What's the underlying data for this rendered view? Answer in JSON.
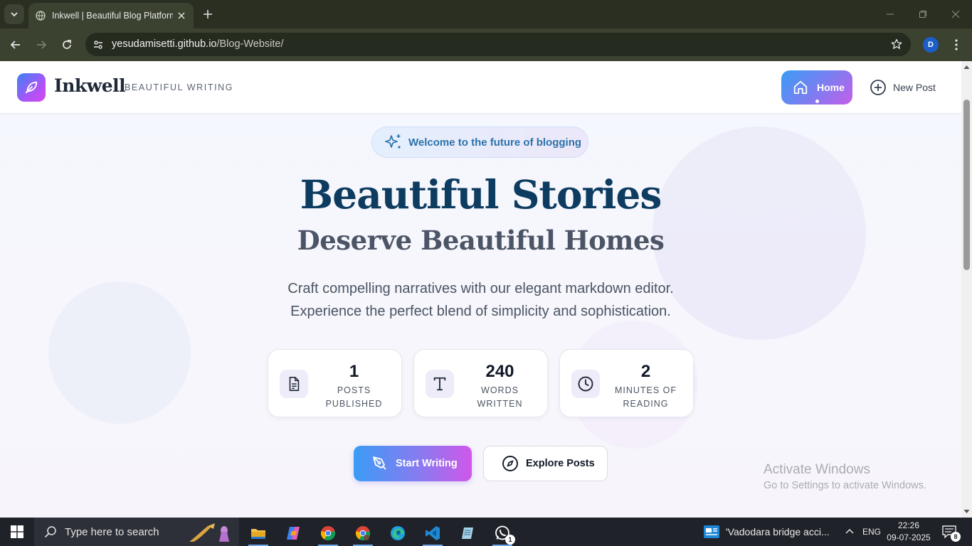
{
  "browser": {
    "tab_title": "Inkwell | Beautiful Blog Platform",
    "url_host": "yesudamisetti.github.io",
    "url_path": "/Blog-Website/",
    "profile_initial": "D"
  },
  "header": {
    "brand": "Inkwell",
    "tagline": "BEAUTIFUL WRITING",
    "nav": [
      {
        "label": "Home",
        "icon": "home-icon",
        "active": true
      },
      {
        "label": "New Post",
        "icon": "plus-circle-icon",
        "active": false
      }
    ]
  },
  "hero": {
    "badge": "Welcome to the future of blogging",
    "title": "Beautiful Stories",
    "subtitle": "Deserve Beautiful Homes",
    "description_line1": "Craft compelling narratives with our elegant markdown editor.",
    "description_line2": "Experience the perfect blend of simplicity and sophistication."
  },
  "stats": [
    {
      "value": "1",
      "caption_line1": "POSTS",
      "caption_line2": "PUBLISHED",
      "icon": "document-icon"
    },
    {
      "value": "240",
      "caption_line1": "WORDS",
      "caption_line2": "WRITTEN",
      "icon": "text-type-icon"
    },
    {
      "value": "2",
      "caption_line1": "MINUTES OF",
      "caption_line2": "READING",
      "icon": "clock-icon"
    }
  ],
  "actions": {
    "start_writing": "Start Writing",
    "explore_posts": "Explore Posts"
  },
  "watermark": {
    "line1": "Activate Windows",
    "line2": "Go to Settings to activate Windows."
  },
  "taskbar": {
    "search_placeholder": "Type here to search",
    "news": "'Vadodara bridge acci...",
    "language": "ENG",
    "time": "22:26",
    "date": "09-07-2025",
    "notification_count": "8",
    "whatsapp_count": "1"
  },
  "colors": {
    "brand_gradient_start": "#3b82f6",
    "brand_gradient_end": "#d946ef",
    "title_color": "#0d3c60",
    "chrome_bg": "#3b4230"
  }
}
